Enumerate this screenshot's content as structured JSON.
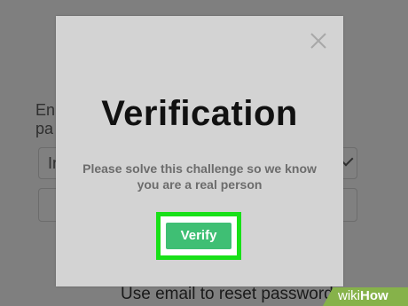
{
  "background": {
    "label_line_1": "En",
    "label_line_2": "pa",
    "select_value": "In",
    "reset_link": "Use email to reset password"
  },
  "modal": {
    "title": "Verification",
    "message": "Please solve this challenge so we know you are a real person",
    "verify_label": "Verify",
    "close_icon": "close-icon"
  },
  "watermark": {
    "prefix": "wiki",
    "suffix": "How"
  },
  "colors": {
    "overlay": "#7f7f7f",
    "modal_bg": "#d3d3d3",
    "verify_button": "#3fbf74",
    "highlight": "#18e018",
    "watermark": "#86b24a"
  }
}
